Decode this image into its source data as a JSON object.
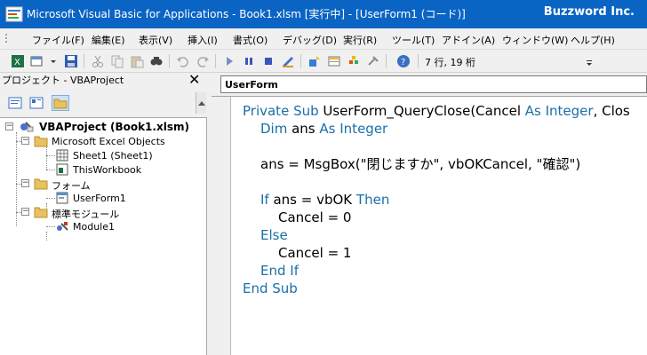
{
  "titlebar": {
    "title": "Microsoft Visual Basic for Applications - Book1.xlsm [実行中] - [UserForm1 (コード)]",
    "brand": "Buzzword Inc."
  },
  "menubar": {
    "items": [
      "ファイル(F)",
      "編集(E)",
      "表示(V)",
      "挿入(I)",
      "書式(O)",
      "デバッグ(D)",
      "実行(R)",
      "ツール(T)",
      "アドイン(A)",
      "ウィンドウ(W)",
      "ヘルプ(H)"
    ]
  },
  "toolbar": {
    "position": "7 行, 19 桁"
  },
  "project": {
    "title": "プロジェクト - VBAProject",
    "close": "✕",
    "root": "VBAProject (Book1.xlsm)",
    "excel_objects": "Microsoft Excel Objects",
    "sheet1": "Sheet1 (Sheet1)",
    "thisworkbook": "ThisWorkbook",
    "forms": "フォーム",
    "userform1": "UserForm1",
    "modules": "標準モジュール",
    "module1": "Module1"
  },
  "code": {
    "object": "UserForm",
    "lines": [
      {
        "kw1": "Private Sub ",
        "t1": "UserForm_QueryClose(Cancel ",
        "kw2": "As Integer",
        "t2": ", Clos"
      },
      {
        "kw1": "Dim ",
        "t1": "ans ",
        "kw2": "As Integer",
        "t2": ""
      },
      {
        "kw1": "",
        "t1": "ans = MsgBox(\"閉じますか\", vbOKCancel, \"確認\")",
        "kw2": "",
        "t2": ""
      },
      {
        "kw1": "If ",
        "t1": "ans = vbOK ",
        "kw2": "Then",
        "t2": ""
      },
      {
        "kw1": "",
        "t1": "Cancel = 0",
        "kw2": "",
        "t2": ""
      },
      {
        "kw1": "Else",
        "t1": "",
        "kw2": "",
        "t2": ""
      },
      {
        "kw1": "",
        "t1": "Cancel = 1",
        "kw2": "",
        "t2": ""
      },
      {
        "kw1": "End If",
        "t1": "",
        "kw2": "",
        "t2": ""
      },
      {
        "kw1": "End Sub",
        "t1": "",
        "kw2": "",
        "t2": ""
      }
    ]
  },
  "colors": {
    "titlebar": "#0a64c4",
    "keyword": "#1a6fa8"
  }
}
